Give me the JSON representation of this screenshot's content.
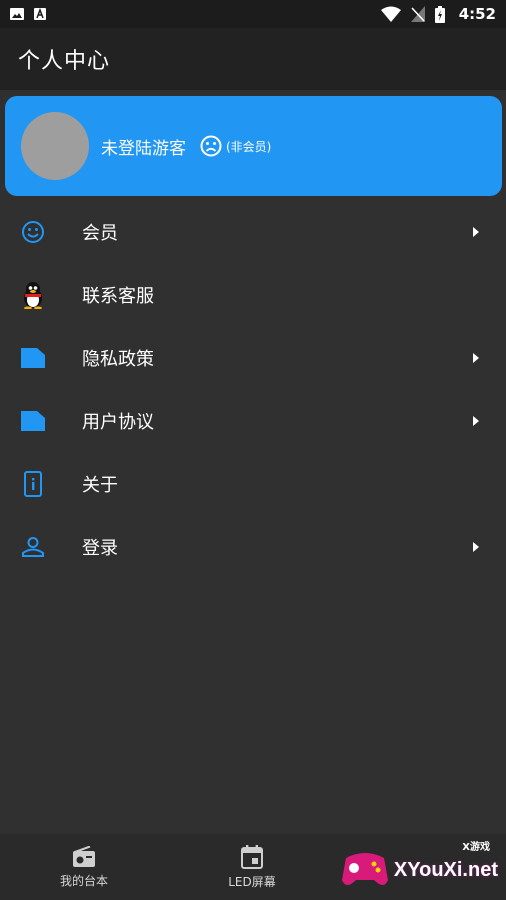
{
  "status_bar": {
    "time": "4:52",
    "icons": [
      "image-icon",
      "a-icon",
      "wifi-icon",
      "no-signal-icon",
      "battery-icon"
    ]
  },
  "app_bar": {
    "title": "个人中心"
  },
  "profile": {
    "username": "未登陆游客",
    "member_status": "(非会员)",
    "status_icon": "sad-face-icon"
  },
  "menu": {
    "items": [
      {
        "label": "会员",
        "icon": "smile-icon",
        "has_chevron": true
      },
      {
        "label": "联系客服",
        "icon": "qq-penguin-icon",
        "has_chevron": false
      },
      {
        "label": "隐私政策",
        "icon": "document-icon",
        "has_chevron": true
      },
      {
        "label": "用户协议",
        "icon": "document-icon",
        "has_chevron": true
      },
      {
        "label": "关于",
        "icon": "info-phone-icon",
        "has_chevron": false
      },
      {
        "label": "登录",
        "icon": "person-icon",
        "has_chevron": true
      }
    ]
  },
  "bottom_nav": {
    "items": [
      {
        "label": "我的台本",
        "icon": "radio-icon"
      },
      {
        "label": "LED屏幕",
        "icon": "calendar-icon"
      }
    ]
  },
  "watermark": {
    "text": "XYouXi.net",
    "sub": "X游戏"
  },
  "colors": {
    "accent": "#2196f3",
    "background": "#303030",
    "app_bar": "#222222",
    "avatar": "#9e9e9e"
  }
}
